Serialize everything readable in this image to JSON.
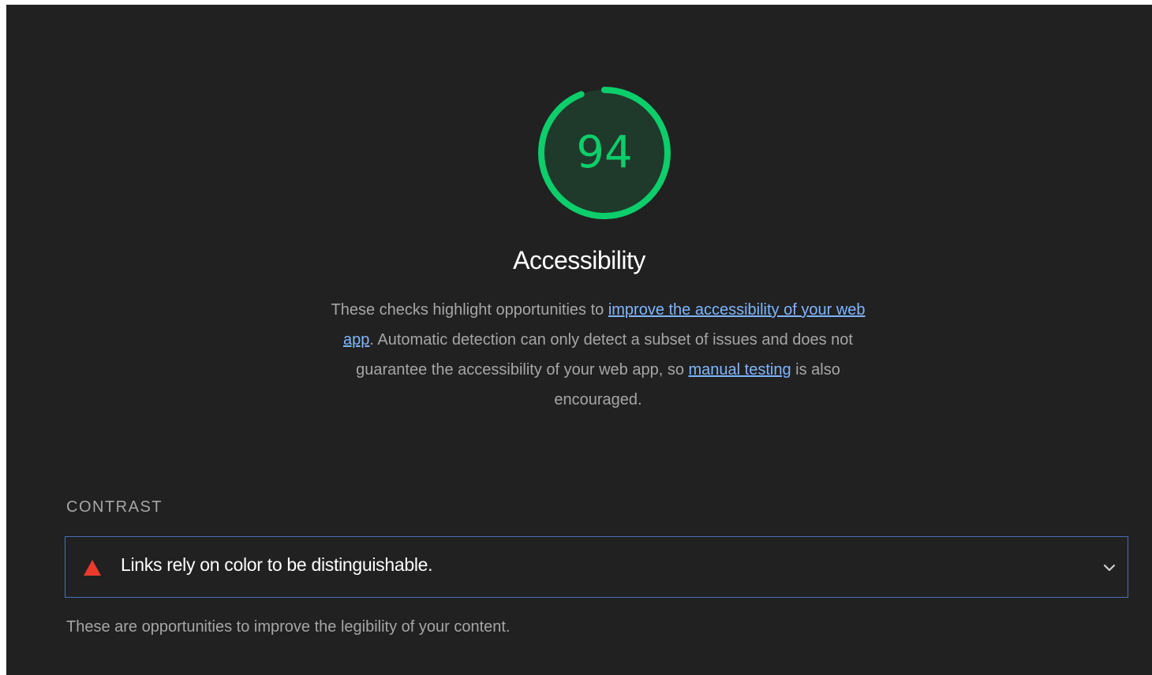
{
  "score": {
    "value": "94",
    "fraction": 0.94,
    "color": "#0cce6b"
  },
  "category": {
    "title": "Accessibility",
    "description": {
      "text_1": "These checks highlight opportunities to ",
      "link_1": "improve the accessibility of your web app",
      "text_2": ". Automatic detection can only detect a subset of issues and does not guarantee the accessibility of your web app, so ",
      "link_2": "manual testing",
      "text_3": " is also encouraged."
    }
  },
  "group": {
    "title": "CONTRAST",
    "description": "These are opportunities to improve the legibility of your content."
  },
  "audit": {
    "title": "Links rely on color to be distinguishable.",
    "status_icon": "fail-triangle-icon",
    "status_color": "#eb3a2c",
    "expand_icon": "chevron-down-icon"
  }
}
